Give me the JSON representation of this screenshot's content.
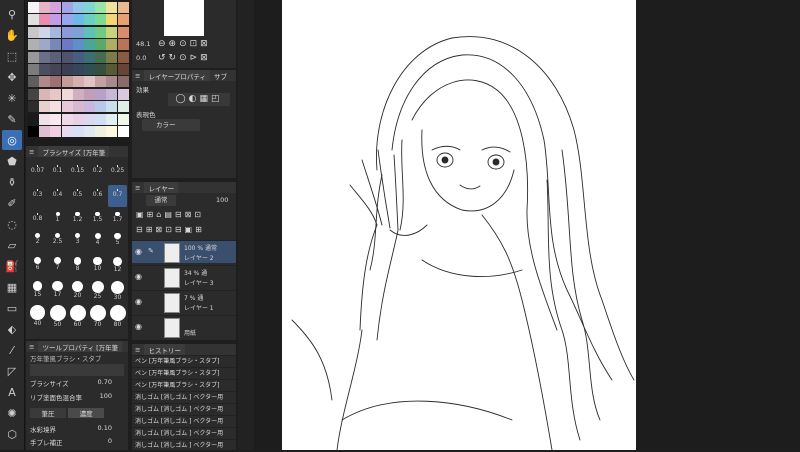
{
  "tools": [
    "magic-wand",
    "hand",
    "selection-rect",
    "move",
    "sparkle",
    "pen",
    "selection",
    "fill",
    "eyedropper",
    "brush",
    "smudge",
    "eraser",
    "bucket",
    "gradient",
    "shape",
    "blend",
    "line",
    "figure",
    "text",
    "effect",
    "balloon"
  ],
  "active_tool_index": 6,
  "brush_size_panel": {
    "tab_label": "ブラシサイズ [万年筆",
    "sizes": [
      "0.07",
      "0.1",
      "0.15",
      "0.2",
      "0.25",
      "0.3",
      "0.4",
      "0.5",
      "0.6",
      "0.7",
      "0.8",
      "1",
      "1.2",
      "1.5",
      "1.7",
      "2",
      "2.5",
      "3",
      "4",
      "5",
      "6",
      "7",
      "8",
      "10",
      "12",
      "15",
      "17",
      "20",
      "25",
      "30",
      "40",
      "50",
      "60",
      "70",
      "80"
    ],
    "selected": "0.7"
  },
  "tool_property": {
    "tab_label": "ツールプロパティ [万年筆",
    "tool_name": "万年筆風ブラシ・スタブ",
    "brush_size_label": "ブラシサイズ",
    "brush_size_value": "0.70",
    "mix_label": "リブ塗面色混合率",
    "mix_value": "100",
    "mode_a": "筆圧",
    "mode_b": "濃度",
    "watercolor_label": "水彩境界",
    "watercolor_value": "0.10",
    "stabilize_label": "手ブレ補正",
    "stabilize_value": "0"
  },
  "navigator": {
    "zoom": "48.1",
    "rotation": "0.0"
  },
  "layer_property": {
    "tab_label": "レイヤープロパティ",
    "tab2": "サブ",
    "effect_label": "効果",
    "display_color_label": "表現色",
    "display_color_value": "カラー"
  },
  "layers_panel": {
    "tab_label": "レイヤー",
    "blend_mode": "通常",
    "opacity": "100",
    "rows": [
      {
        "percent": "100 %",
        "mode": "通常",
        "name": "レイヤー 2"
      },
      {
        "percent": "34 %",
        "mode": "通",
        "name": "レイヤー 3"
      },
      {
        "percent": "7 %",
        "mode": "通",
        "name": "レイヤー 1"
      },
      {
        "percent": "",
        "mode": "",
        "name": "用紙"
      }
    ]
  },
  "history_panel": {
    "tab_label": "ヒストリー",
    "items": [
      "ペン [万年筆風ブラシ・スタブ]",
      "ペン [万年筆風ブラシ・スタブ]",
      "ペン [万年筆風ブラシ・スタブ]",
      "消しゴム [消しゴム ] ベクター用",
      "消しゴム [消しゴム ] ベクター用",
      "消しゴム [消しゴム ] ベクター用",
      "消しゴム [消しゴム ] ベクター用",
      "消しゴム [消しゴム ] ベクター用"
    ]
  },
  "colors": {
    "accent": "#3b6fb5",
    "panel_bg": "#2b2b2b",
    "canvas_bg": "#1d1d1d",
    "paper": "#ffffff"
  }
}
